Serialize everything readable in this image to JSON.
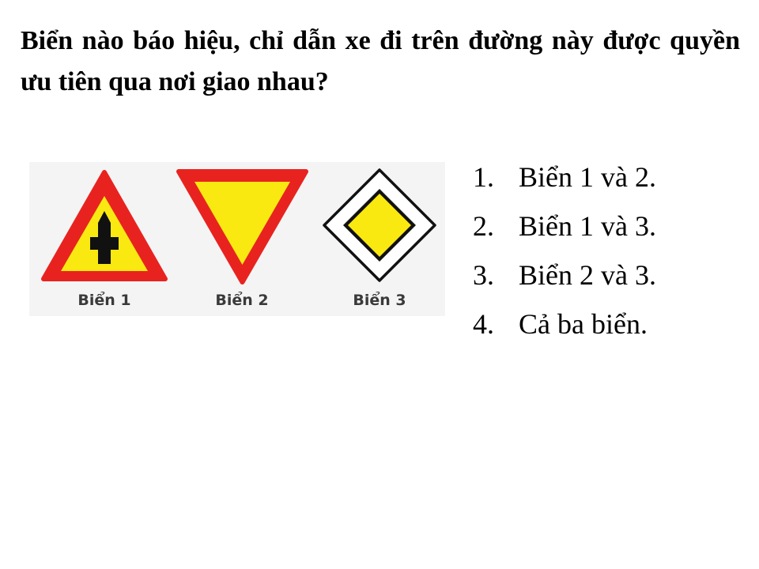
{
  "question": "Biển nào báo hiệu, chỉ dẫn xe đi trên đường này được quyền ưu tiên qua nơi giao nhau?",
  "signs": [
    {
      "caption": "Biển 1",
      "icon": "priority-intersection-warning-icon"
    },
    {
      "caption": "Biển 2",
      "icon": "give-way-icon"
    },
    {
      "caption": "Biển 3",
      "icon": "priority-road-icon"
    }
  ],
  "colors": {
    "sign_red": "#e8231f",
    "sign_yellow": "#f9e911",
    "symbol_black": "#111111",
    "caption_gray": "#3a3a3a"
  },
  "answers": [
    {
      "number": "1.",
      "text": "Biển 1 và 2."
    },
    {
      "number": "2.",
      "text": "Biển 1 và 3."
    },
    {
      "number": "3.",
      "text": "Biển 2 và 3."
    },
    {
      "number": "4.",
      "text": "Cả ba biển."
    }
  ]
}
